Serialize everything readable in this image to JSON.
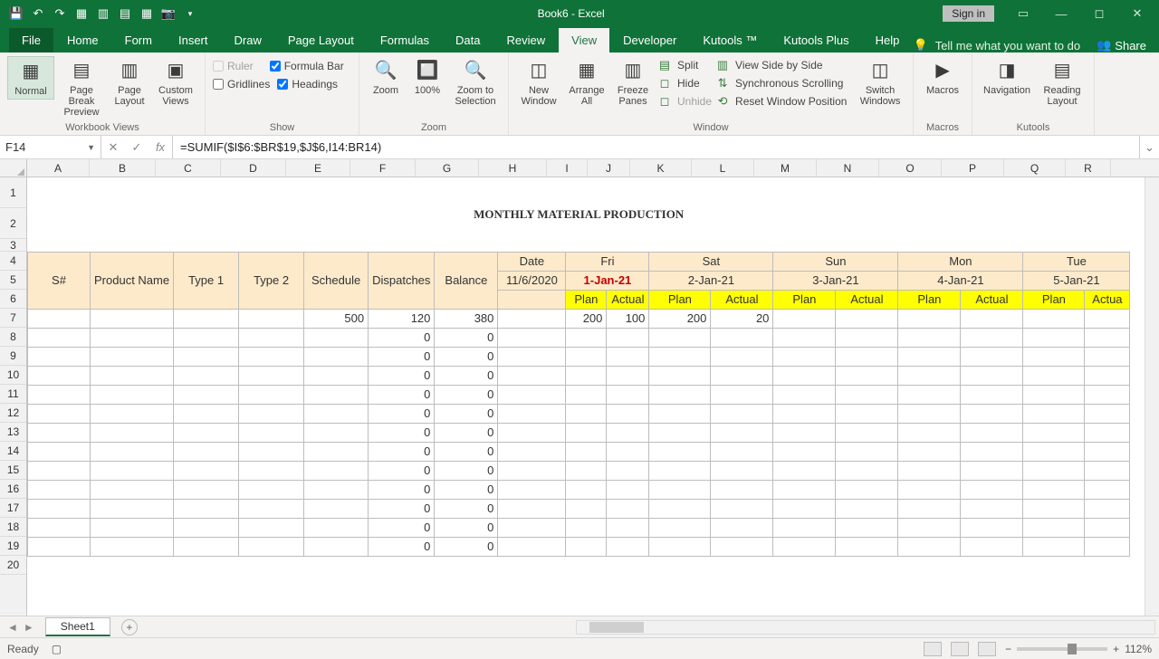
{
  "titlebar": {
    "title": "Book6 - Excel",
    "signin": "Sign in",
    "qat": [
      "save-icon",
      "undo-icon",
      "redo-icon",
      "new-icon",
      "open-icon",
      "preview-icon",
      "email-icon",
      "camera-icon"
    ]
  },
  "tabs": {
    "items": [
      "File",
      "Home",
      "Form",
      "Insert",
      "Draw",
      "Page Layout",
      "Formulas",
      "Data",
      "Review",
      "View",
      "Developer",
      "Kutools ™",
      "Kutools Plus",
      "Help"
    ],
    "active": "View",
    "tellme": "Tell me what you want to do",
    "share": "Share"
  },
  "ribbon": {
    "views": {
      "normal": "Normal",
      "pagebreak": "Page Break Preview",
      "pagelayout": "Page Layout",
      "custom": "Custom Views",
      "group": "Workbook Views"
    },
    "show": {
      "ruler": "Ruler",
      "gridlines": "Gridlines",
      "formulabar": "Formula Bar",
      "headings": "Headings",
      "group": "Show"
    },
    "zoom": {
      "zoom": "Zoom",
      "hundred": "100%",
      "selection": "Zoom to Selection",
      "group": "Zoom"
    },
    "window": {
      "neww": "New Window",
      "arrange": "Arrange All",
      "freeze": "Freeze Panes",
      "split": "Split",
      "hide": "Hide",
      "unhide": "Unhide",
      "sidebyside": "View Side by Side",
      "syncscroll": "Synchronous Scrolling",
      "resetpos": "Reset Window Position",
      "switch": "Switch Windows",
      "group": "Window"
    },
    "macros": {
      "macros": "Macros",
      "group": "Macros"
    },
    "kutools": {
      "nav": "Navigation",
      "reading": "Reading Layout",
      "group": "Kutools"
    }
  },
  "formula": {
    "cellref": "F14",
    "text": "=SUMIF($I$6:$BR$19,$J$6,I14:BR14)"
  },
  "columns": [
    "A",
    "B",
    "C",
    "D",
    "E",
    "F",
    "G",
    "H",
    "I",
    "J",
    "K",
    "L",
    "M",
    "N",
    "O",
    "P",
    "Q",
    "R"
  ],
  "rows": [
    "1",
    "2",
    "3",
    "4",
    "5",
    "6",
    "7",
    "8",
    "9",
    "10",
    "11",
    "12",
    "13",
    "14",
    "15",
    "16",
    "17",
    "18",
    "19",
    "20"
  ],
  "sheet": {
    "title": "MONTHLY MATERIAL PRODUCTION",
    "headers": {
      "snum": "S#",
      "pname": "Product Name",
      "t1": "Type 1",
      "t2": "Type 2",
      "sched": "Schedule",
      "disp": "Dispatches",
      "bal": "Balance",
      "date": "Date",
      "basedate": "11/6/2020",
      "days": [
        {
          "day": "Fri",
          "date": "1-Jan-21",
          "highlight": true
        },
        {
          "day": "Sat",
          "date": "2-Jan-21"
        },
        {
          "day": "Sun",
          "date": "3-Jan-21"
        },
        {
          "day": "Mon",
          "date": "4-Jan-21"
        },
        {
          "day": "Tue",
          "date": "5-Jan-21"
        }
      ],
      "plan": "Plan",
      "actual": "Actual"
    },
    "rowsdata": [
      {
        "sched": "500",
        "disp": "120",
        "bal": "380",
        "iplan": "200",
        "iact": "100",
        "kplan": "200",
        "kact": "20"
      },
      {
        "disp": "0",
        "bal": "0"
      },
      {
        "disp": "0",
        "bal": "0"
      },
      {
        "disp": "0",
        "bal": "0"
      },
      {
        "disp": "0",
        "bal": "0"
      },
      {
        "disp": "0",
        "bal": "0"
      },
      {
        "disp": "0",
        "bal": "0"
      },
      {
        "disp": "0",
        "bal": "0"
      },
      {
        "disp": "0",
        "bal": "0"
      },
      {
        "disp": "0",
        "bal": "0"
      },
      {
        "disp": "0",
        "bal": "0"
      },
      {
        "disp": "0",
        "bal": "0"
      },
      {
        "disp": "0",
        "bal": "0"
      }
    ]
  },
  "sheettab": "Sheet1",
  "status": {
    "ready": "Ready",
    "zoom": "112%"
  }
}
